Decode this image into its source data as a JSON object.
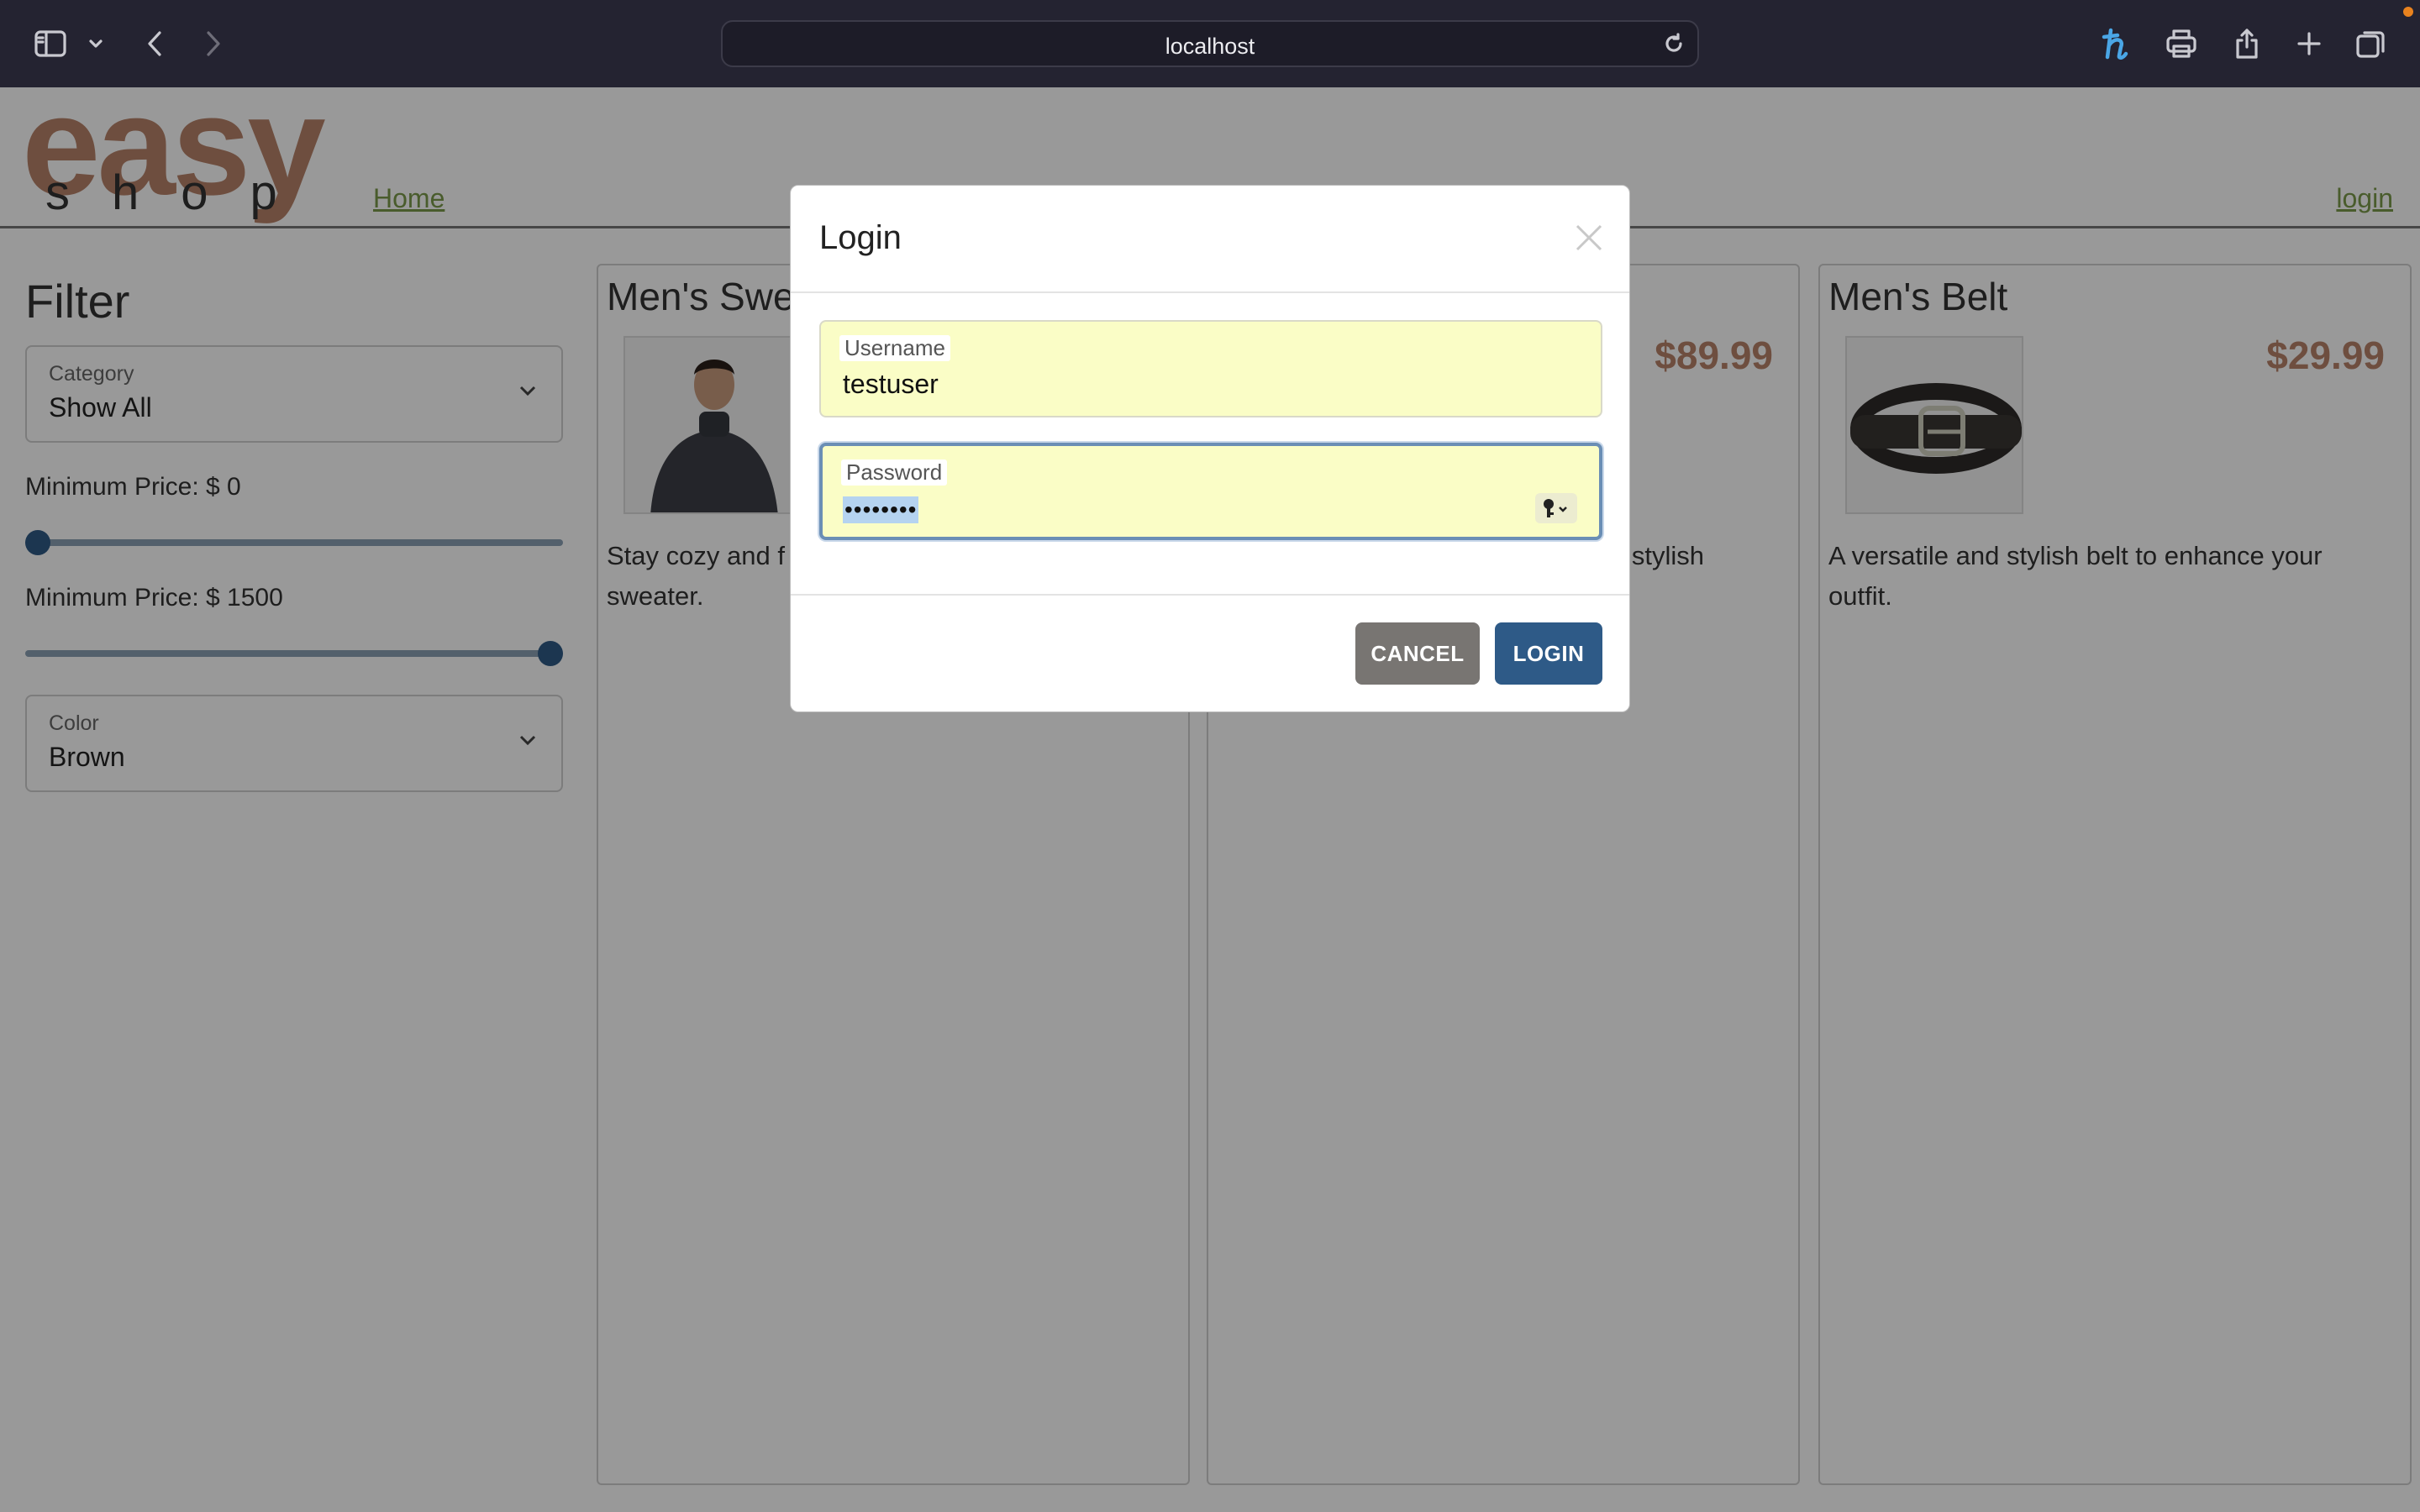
{
  "browser": {
    "url": "localhost"
  },
  "site": {
    "logo_top": "easy",
    "logo_bottom": "shop",
    "nav_home": "Home",
    "nav_login": "login"
  },
  "filter": {
    "title": "Filter",
    "category": {
      "label": "Category",
      "value": "Show All"
    },
    "min_price": {
      "label": "Minimum Price: $ 0",
      "value": 0
    },
    "max_price": {
      "label": "Minimum Price: $ 1500",
      "value": 1500
    },
    "color": {
      "label": "Color",
      "value": "Brown"
    }
  },
  "products": [
    {
      "title": "Men's Swe",
      "price": "",
      "description": "Stay cozy and f\nsweater."
    },
    {
      "title": "",
      "price": "$89.99",
      "description": "e stylish"
    },
    {
      "title": "Men's Belt",
      "price": "$29.99",
      "description": "A versatile and stylish belt to enhance your outfit."
    }
  ],
  "modal": {
    "title": "Login",
    "username_label": "Username",
    "username_value": "testuser",
    "password_label": "Password",
    "password_value": "••••••••",
    "cancel_label": "CANCEL",
    "login_label": "LOGIN"
  },
  "colors": {
    "accent": "#2e5a87",
    "brand": "#b8836a",
    "link": "#7a9a4a",
    "autofill": "#fafdc6"
  }
}
